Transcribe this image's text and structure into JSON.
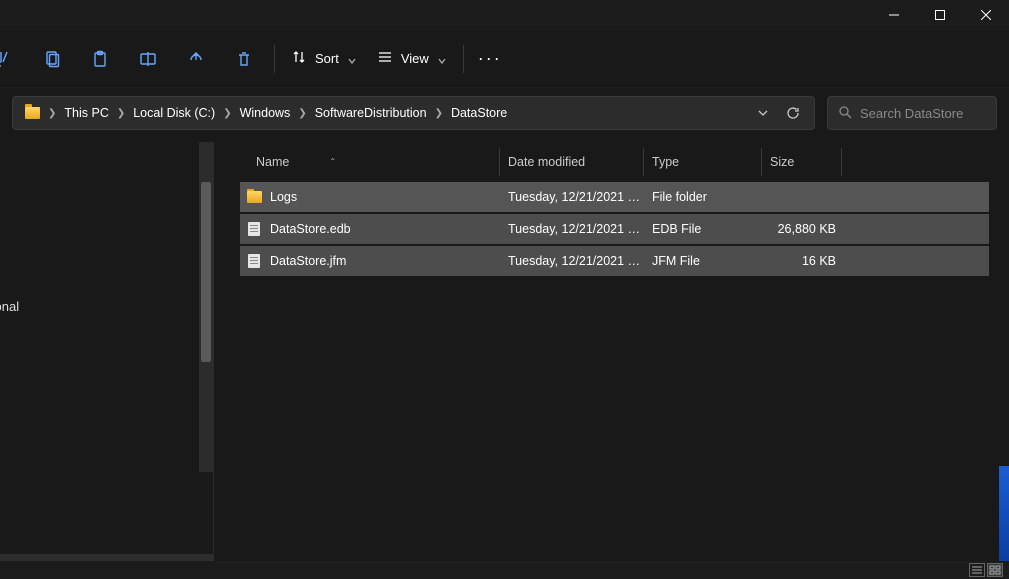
{
  "toolbar": {
    "sort_label": "Sort",
    "view_label": "View"
  },
  "breadcrumb": [
    "This PC",
    "Local Disk (C:)",
    "Windows",
    "SoftwareDistribution",
    "DataStore"
  ],
  "search": {
    "placeholder": "Search DataStore"
  },
  "columns": {
    "name": "Name",
    "date": "Date modified",
    "type": "Type",
    "size": "Size"
  },
  "files": [
    {
      "name": "Logs",
      "date": "Tuesday, 12/21/2021 1...",
      "type": "File folder",
      "size": "",
      "icon": "folder"
    },
    {
      "name": "DataStore.edb",
      "date": "Tuesday, 12/21/2021 1...",
      "type": "EDB File",
      "size": "26,880 KB",
      "icon": "file"
    },
    {
      "name": "DataStore.jfm",
      "date": "Tuesday, 12/21/2021 1...",
      "type": "JFM File",
      "size": "16 KB",
      "icon": "file"
    }
  ],
  "sidebar": {
    "item_personal": "sonal",
    "item_selected": ")"
  },
  "status": {
    "text": ""
  }
}
